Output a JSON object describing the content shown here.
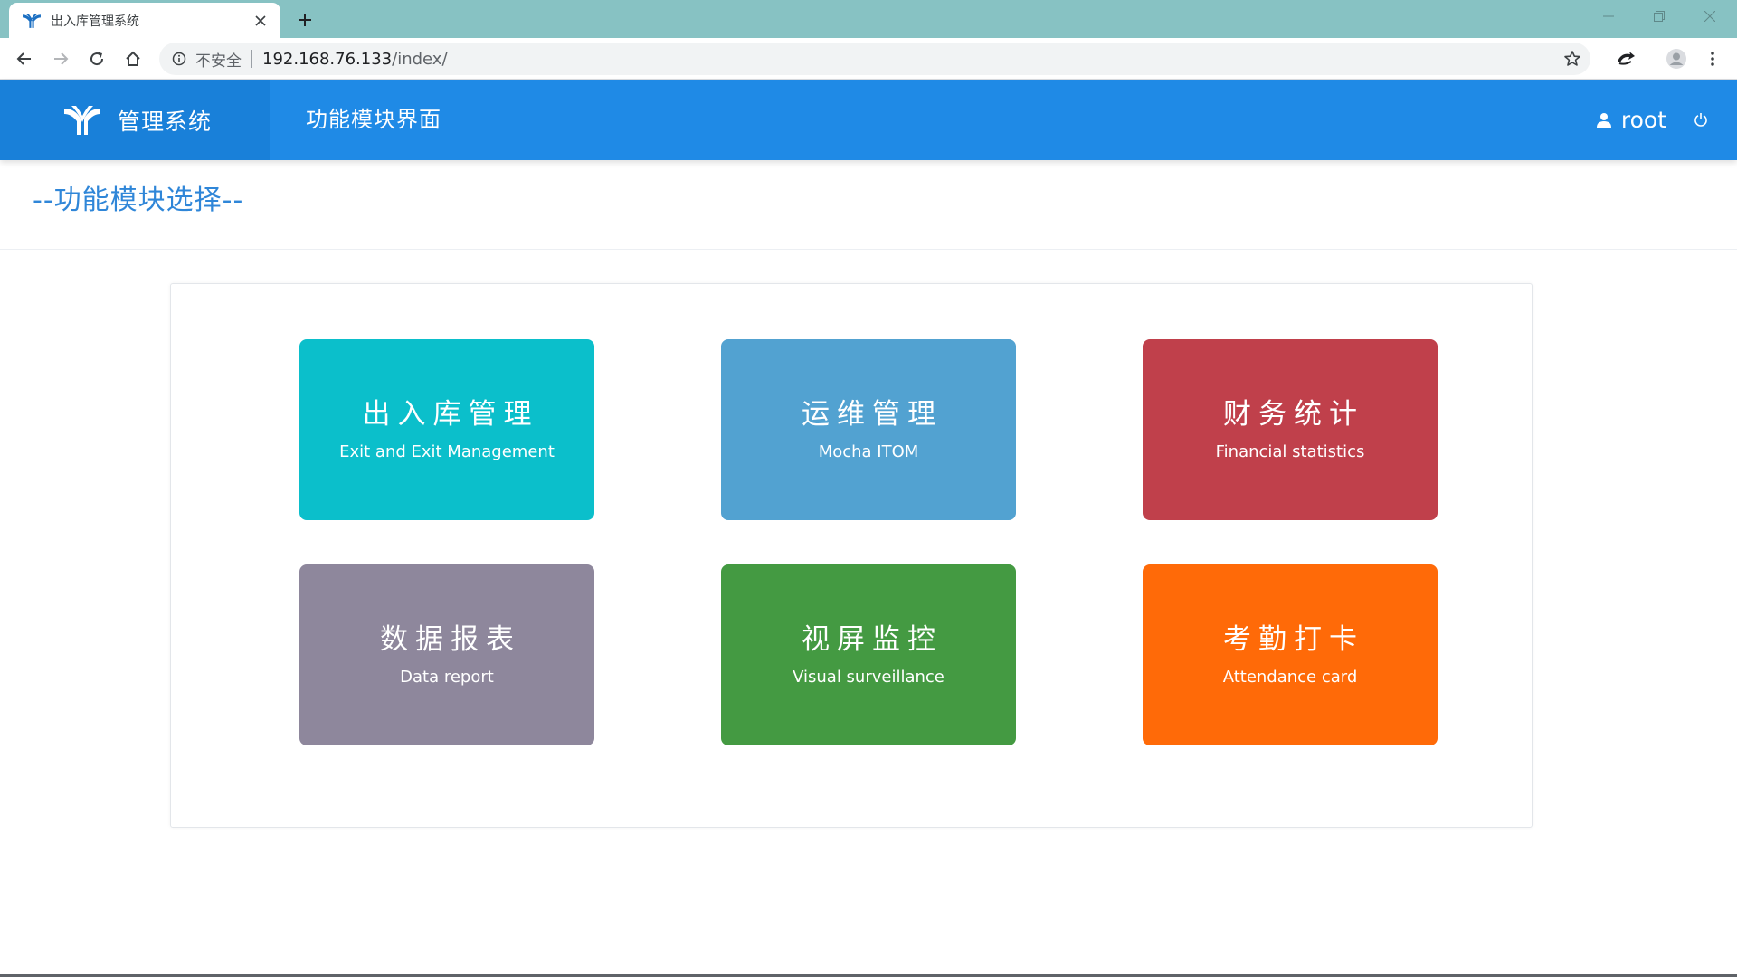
{
  "browser": {
    "tab_title": "出入库管理系统",
    "omnibox": {
      "security_label": "不安全",
      "url_host": "192.168.76.133",
      "url_path": "/index/"
    }
  },
  "header": {
    "brand_name": "管理系统",
    "page_heading": "功能模块界面",
    "username": "root",
    "color": "#1f8ae6"
  },
  "main": {
    "section_title": "--功能模块选择--",
    "modules": [
      {
        "title": "出入库管理",
        "subtitle": "Exit and Exit Management",
        "color": "#0bbfcb"
      },
      {
        "title": "运维管理",
        "subtitle": "Mocha ITOM",
        "color": "#52a2d1"
      },
      {
        "title": "财务统计",
        "subtitle": "Financial statistics",
        "color": "#c0404b"
      },
      {
        "title": "数据报表",
        "subtitle": "Data report",
        "color": "#8e879c"
      },
      {
        "title": "视屏监控",
        "subtitle": "Visual surveillance",
        "color": "#449a42"
      },
      {
        "title": "考勤打卡",
        "subtitle": "Attendance card",
        "color": "#ff6a08"
      }
    ]
  },
  "icons": [
    "logo-icon",
    "close-icon",
    "plus-icon",
    "minimize-icon",
    "restore-icon",
    "window-close-icon",
    "back-arrow-icon",
    "forward-arrow-icon",
    "reload-icon",
    "home-icon",
    "info-icon",
    "star-icon",
    "extension-icon",
    "profile-icon",
    "menu-dots-icon",
    "user-icon",
    "power-icon"
  ]
}
